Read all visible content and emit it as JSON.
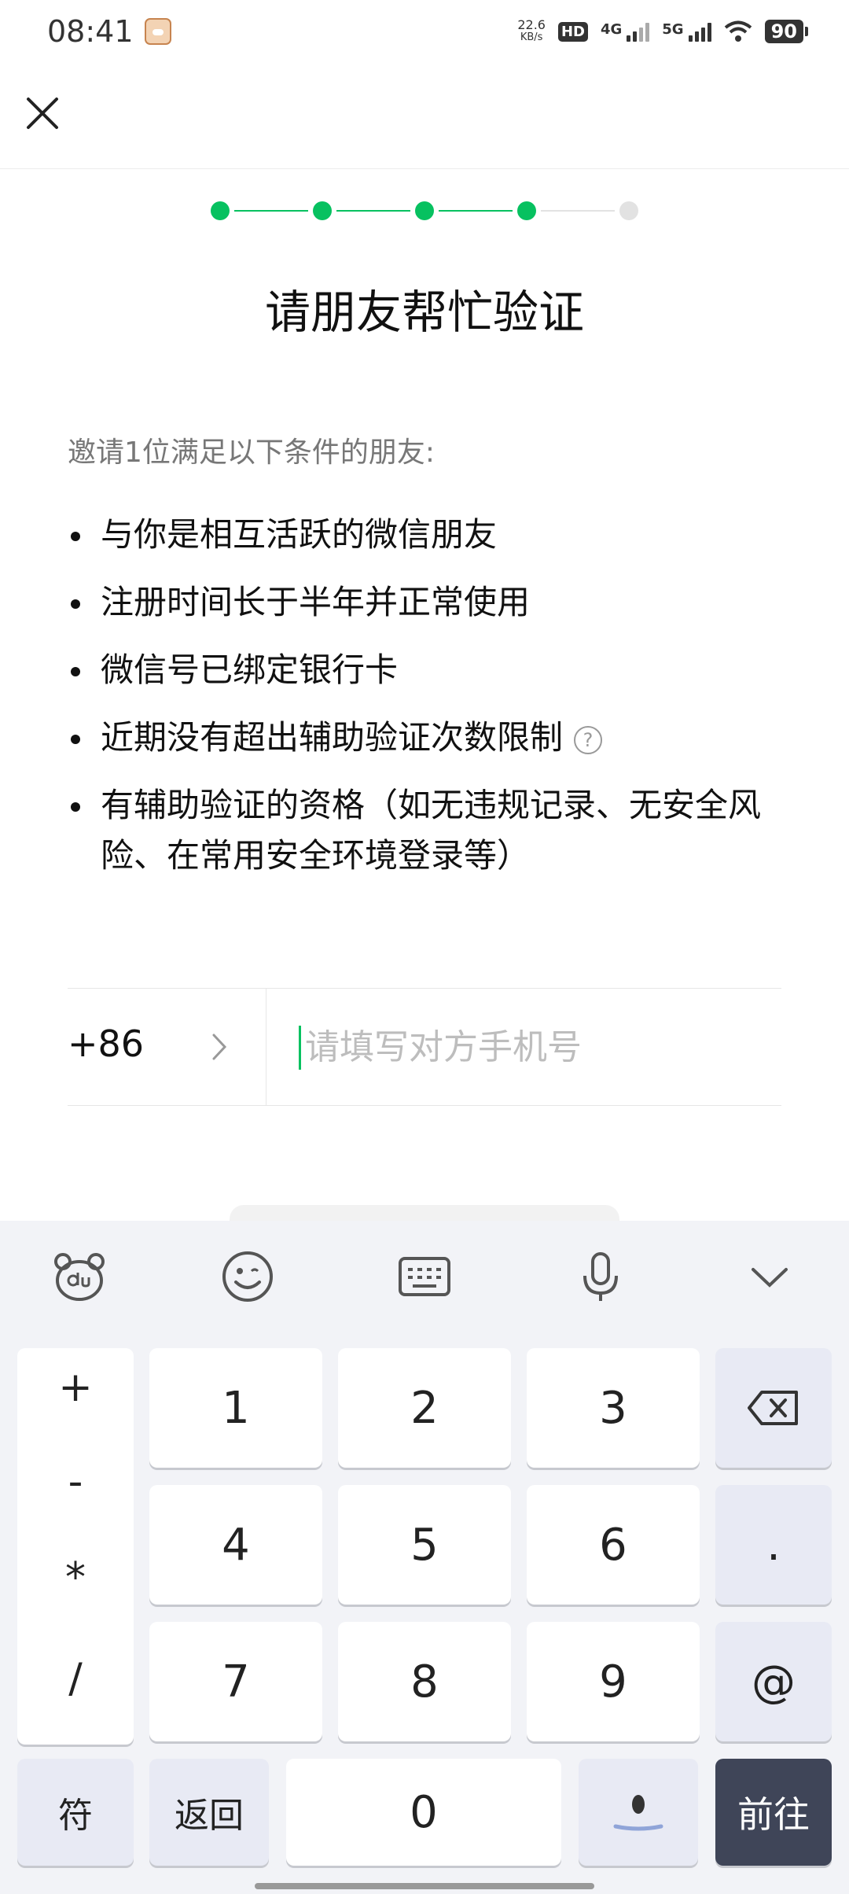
{
  "status_bar": {
    "time": "08:41",
    "net_speed_value": "22.6",
    "net_speed_unit": "KB/s",
    "hd_label": "HD",
    "sim1_label": "4G",
    "sim2_label": "5G",
    "battery": "90"
  },
  "progress": {
    "total_steps": 5,
    "completed_steps": 4
  },
  "page": {
    "title": "请朋友帮忙验证",
    "subtitle": "邀请1位满足以下条件的朋友:",
    "conditions": [
      "与你是相互活跃的微信朋友",
      "注册时间长于半年并正常使用",
      "微信号已绑定银行卡",
      "近期没有超出辅助验证次数限制",
      "有辅助验证的资格（如无违规记录、无安全风险、在常用安全环境登录等）"
    ],
    "help_glyph": "?"
  },
  "phone": {
    "country_code": "+86",
    "placeholder": "请填写对方手机号",
    "value": ""
  },
  "keyboard": {
    "symbols": [
      "+",
      "-",
      "*",
      "/"
    ],
    "rows": [
      [
        "1",
        "2",
        "3"
      ],
      [
        "4",
        "5",
        "6"
      ],
      [
        "7",
        "8",
        "9"
      ]
    ],
    "side_keys": [
      ".",
      "@"
    ],
    "symbol_key": "符",
    "back_key": "返回",
    "zero_key": "0",
    "go_key": "前往"
  },
  "colors": {
    "accent": "#07c160",
    "pending": "#e2e2e2",
    "go_key": "#3f4558"
  }
}
